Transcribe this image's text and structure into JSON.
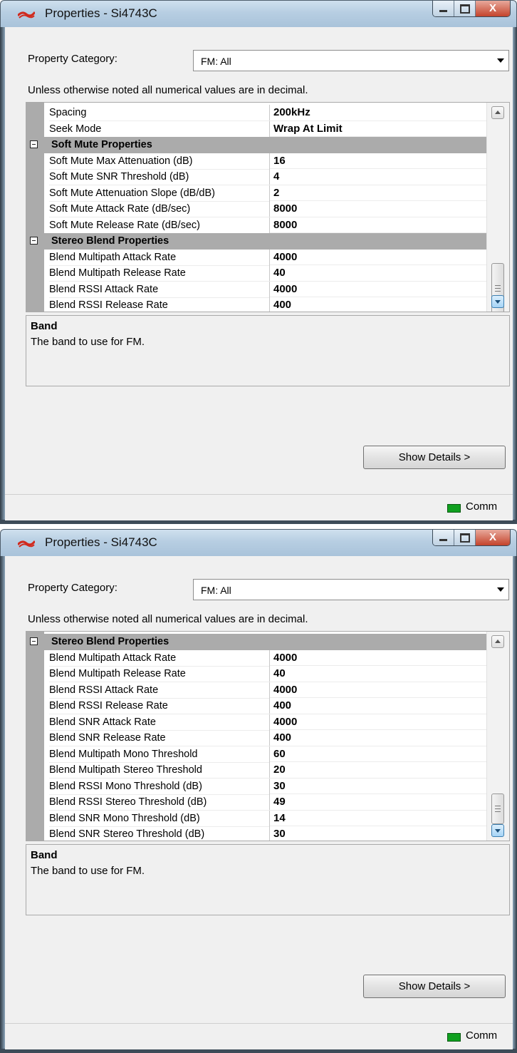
{
  "app": {
    "title": "Properties - Si4743C"
  },
  "windows": [
    {
      "category_label": "Property Category:",
      "category_value": "FM: All",
      "note": "Unless otherwise noted all numerical values are in decimal.",
      "rows": [
        {
          "kind": "prop",
          "name": "Spacing",
          "value": "200kHz"
        },
        {
          "kind": "prop",
          "name": "Seek Mode",
          "value": "Wrap At Limit"
        },
        {
          "kind": "category",
          "name": "Soft Mute Properties"
        },
        {
          "kind": "prop",
          "name": "Soft Mute Max Attenuation (dB)",
          "value": "16"
        },
        {
          "kind": "prop",
          "name": "Soft Mute SNR Threshold (dB)",
          "value": "4"
        },
        {
          "kind": "prop",
          "name": "Soft Mute Attenuation Slope (dB/dB)",
          "value": "2"
        },
        {
          "kind": "prop",
          "name": "Soft Mute Attack Rate (dB/sec)",
          "value": "8000"
        },
        {
          "kind": "prop",
          "name": "Soft Mute Release Rate (dB/sec)",
          "value": "8000"
        },
        {
          "kind": "category",
          "name": "Stereo Blend Properties"
        },
        {
          "kind": "prop",
          "name": "Blend Multipath Attack Rate",
          "value": "4000"
        },
        {
          "kind": "prop",
          "name": "Blend Multipath Release Rate",
          "value": "40"
        },
        {
          "kind": "prop",
          "name": "Blend RSSI Attack Rate",
          "value": "4000"
        },
        {
          "kind": "prop",
          "name": "Blend RSSI Release Rate",
          "value": "400"
        }
      ],
      "help_title": "Band",
      "help_text": "The band to use for FM.",
      "details_button": "Show Details >",
      "status_text": "Comm"
    },
    {
      "category_label": "Property Category:",
      "category_value": "FM: All",
      "note": "Unless otherwise noted all numerical values are in decimal.",
      "rows": [
        {
          "kind": "category",
          "name": "Stereo Blend Properties"
        },
        {
          "kind": "prop",
          "name": "Blend Multipath Attack Rate",
          "value": "4000"
        },
        {
          "kind": "prop",
          "name": "Blend Multipath Release Rate",
          "value": "40"
        },
        {
          "kind": "prop",
          "name": "Blend RSSI Attack Rate",
          "value": "4000"
        },
        {
          "kind": "prop",
          "name": "Blend RSSI Release Rate",
          "value": "400"
        },
        {
          "kind": "prop",
          "name": "Blend SNR Attack Rate",
          "value": "4000"
        },
        {
          "kind": "prop",
          "name": "Blend SNR Release Rate",
          "value": "400"
        },
        {
          "kind": "prop",
          "name": "Blend Multipath Mono Threshold",
          "value": "60"
        },
        {
          "kind": "prop",
          "name": "Blend Multipath Stereo Threshold",
          "value": "20"
        },
        {
          "kind": "prop",
          "name": "Blend RSSI Mono Threshold (dB)",
          "value": "30"
        },
        {
          "kind": "prop",
          "name": "Blend RSSI Stereo Threshold (dB)",
          "value": "49"
        },
        {
          "kind": "prop",
          "name": "Blend SNR Mono Threshold (dB)",
          "value": "14"
        },
        {
          "kind": "prop",
          "name": "Blend SNR Stereo Threshold (dB)",
          "value": "30"
        }
      ],
      "help_title": "Band",
      "help_text": "The band to use for FM.",
      "details_button": "Show Details >",
      "status_text": "Comm"
    }
  ],
  "colors": {
    "category_row": "#ababab",
    "status_led": "#10a020",
    "close_button": "#c4432b"
  },
  "icons": {
    "app_logo": "silicon-labs-logo-icon",
    "minimize": "minimize-icon",
    "maximize": "maximize-icon",
    "close": "close-icon",
    "expand_toggle": "collapse-icon",
    "dropdown": "chevron-down-icon",
    "status": "status-led-icon"
  }
}
